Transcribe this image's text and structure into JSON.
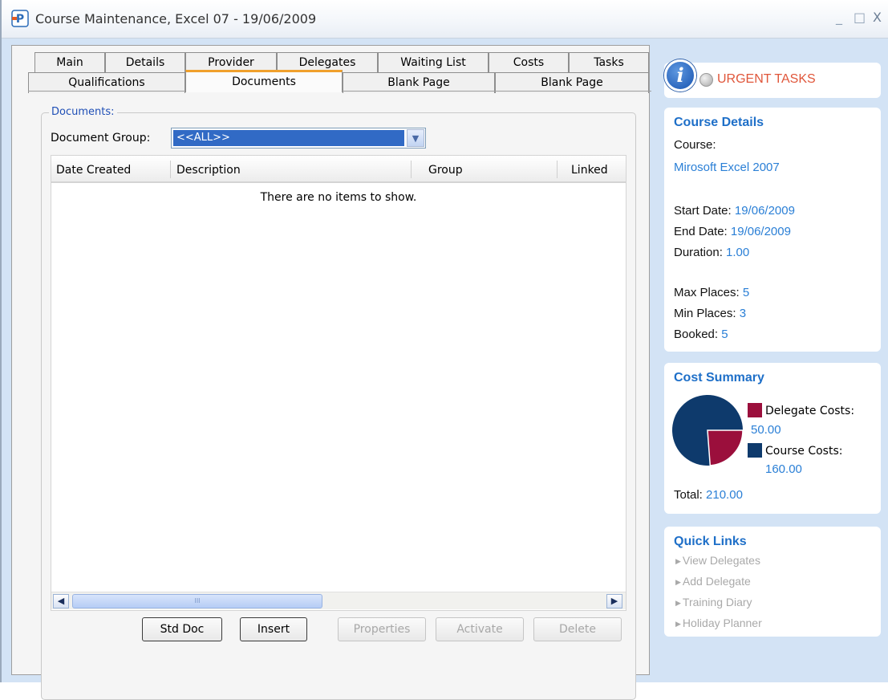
{
  "window": {
    "title": "Course Maintenance, Excel 07 - 19/06/2009",
    "icon_letter": "P",
    "controls": {
      "minimize": "_",
      "maximize": "□",
      "close": "X"
    }
  },
  "tabs": {
    "row1": [
      "Main",
      "Details",
      "Provider",
      "Delegates",
      "Waiting List",
      "Costs",
      "Tasks"
    ],
    "row2": [
      "Qualifications",
      "Documents",
      "Blank Page",
      "Blank Page"
    ],
    "active": "Documents"
  },
  "documents": {
    "group_title": "Documents:",
    "doc_group_label": "Document Group:",
    "doc_group_value": "<<ALL>>",
    "columns": [
      "Date Created",
      "Description",
      "Group",
      "Linked"
    ],
    "empty_message": "There are no items to show.",
    "scroll_thumb_grip": "III",
    "buttons": {
      "std_doc": "Std Doc",
      "insert": "Insert",
      "properties": "Properties",
      "activate": "Activate",
      "delete": "Delete"
    }
  },
  "urgent": {
    "label": "URGENT TASKS",
    "icon_letter": "i"
  },
  "course_details": {
    "title": "Course Details",
    "course_label": "Course:",
    "course_value": "Mirosoft Excel 2007",
    "start_label": "Start Date:",
    "start_value": "19/06/2009",
    "end_label": "End Date:",
    "end_value": "19/06/2009",
    "duration_label": "Duration:",
    "duration_value": "1.00",
    "max_label": "Max Places:",
    "max_value": "5",
    "min_label": "Min Places:",
    "min_value": "3",
    "booked_label": "Booked:",
    "booked_value": "5"
  },
  "cost_summary": {
    "title": "Cost Summary",
    "delegate_label": "Delegate Costs:",
    "delegate_value": "50.00",
    "course_label": "Course Costs:",
    "course_value": "160.00",
    "total_label": "Total:",
    "total_value": "210.00",
    "colors": {
      "delegate": "#9b0f3c",
      "course": "#0e3a6c"
    }
  },
  "chart_data": {
    "type": "pie",
    "categories": [
      "Delegate Costs",
      "Course Costs"
    ],
    "values": [
      50,
      160
    ]
  },
  "quick_links": {
    "title": "Quick Links",
    "items": [
      "View Delegates",
      "Add Delegate",
      "Training Diary",
      "Holiday Planner"
    ]
  }
}
